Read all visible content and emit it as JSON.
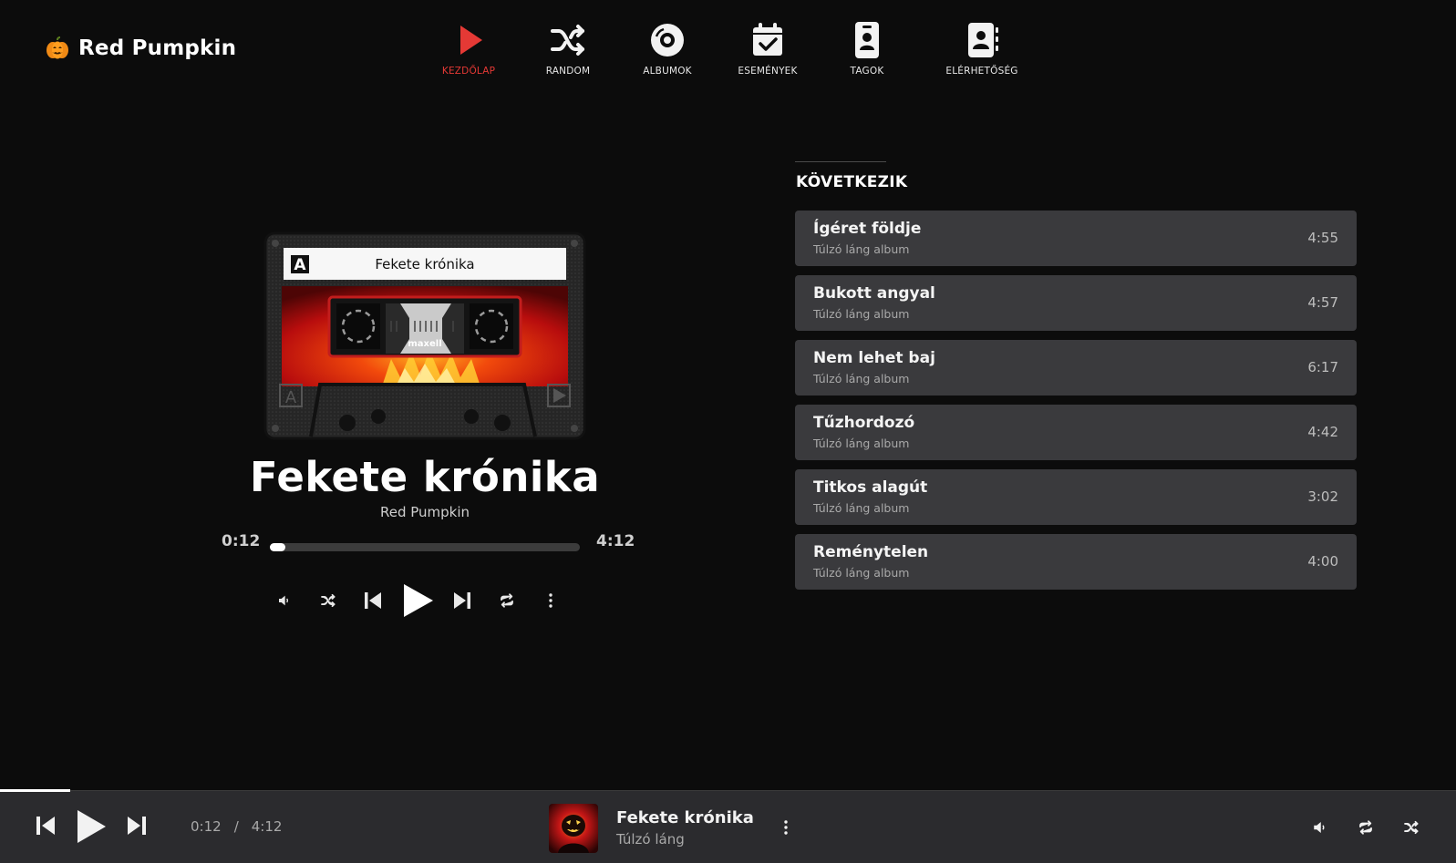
{
  "app": {
    "brand": "Red Pumpkin",
    "logo_icon": "pumpkin-icon",
    "accent": "#e53935"
  },
  "nav": {
    "items": [
      {
        "label": "KEZDŐLAP",
        "icon": "play-icon",
        "active": true
      },
      {
        "label": "RANDOM",
        "icon": "shuffle-icon",
        "active": false
      },
      {
        "label": "ALBUMOK",
        "icon": "disc-icon",
        "active": false
      },
      {
        "label": "ESEMÉNYEK",
        "icon": "calendar-check-icon",
        "active": false
      },
      {
        "label": "TAGOK",
        "icon": "id-badge-icon",
        "active": false
      },
      {
        "label": "ELÉRHETŐSÉG",
        "icon": "contact-book-icon",
        "active": false
      }
    ]
  },
  "player": {
    "cassette_label": "Fekete krónika",
    "cassette_side": "A",
    "cassette_brand": "maxell",
    "title": "Fekete krónika",
    "artist": "Red Pumpkin",
    "current_time": "0:12",
    "total_time": "4:12",
    "progress_fraction": 0.048,
    "controls": [
      "volume-icon",
      "shuffle-icon",
      "previous-icon",
      "play-icon",
      "next-icon",
      "repeat-icon",
      "more-vertical-icon"
    ]
  },
  "queue": {
    "heading": "KÖVETKEZIK",
    "items": [
      {
        "title": "Ígéret földje",
        "album": "Túlzó láng album",
        "duration": "4:55"
      },
      {
        "title": "Bukott angyal",
        "album": "Túlzó láng album",
        "duration": "4:57"
      },
      {
        "title": "Nem lehet baj",
        "album": "Túlzó láng album",
        "duration": "6:17"
      },
      {
        "title": "Tűzhordozó",
        "album": "Túlzó láng album",
        "duration": "4:42"
      },
      {
        "title": "Titkos alagút",
        "album": "Túlzó láng album",
        "duration": "3:02"
      },
      {
        "title": "Reménytelen",
        "album": "Túlzó láng album",
        "duration": "4:00"
      }
    ]
  },
  "bottom_bar": {
    "current_time": "0:12",
    "separator": "/",
    "total_time": "4:12",
    "title": "Fekete krónika",
    "album": "Túlzó láng",
    "progress_fraction": 0.048
  }
}
